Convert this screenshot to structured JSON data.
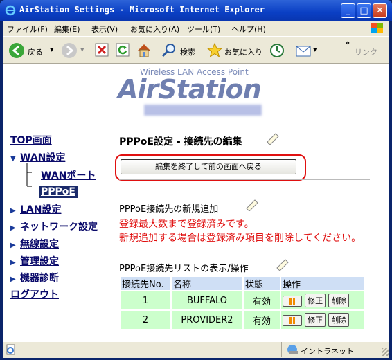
{
  "window": {
    "title": "AirStation Settings - Microsoft Internet Explorer"
  },
  "menu": [
    "ファイル(F)",
    "編集(E)",
    "表示(V)",
    "お気に入り(A)",
    "ツール(T)",
    "ヘルプ(H)"
  ],
  "toolbar": {
    "back": "戻る",
    "search": "検索",
    "favorites": "お気に入り",
    "links": "リンク",
    "chevron": "»"
  },
  "header": {
    "subtitle": "Wireless LAN Access Point",
    "logo": "AirStation"
  },
  "nav": {
    "top": "TOP画面",
    "wan": "WAN設定",
    "wan_port": "WANポート",
    "pppoe": "PPPoE",
    "lan": "LAN設定",
    "network": "ネットワーク設定",
    "wireless": "無線設定",
    "admin": "管理設定",
    "diag": "機器診断",
    "logout": "ログアウト"
  },
  "main": {
    "title": "PPPoE設定 - 接続先の編集",
    "back_button": "編集を終了して前の画面へ戻る",
    "new_section": "PPPoE接続先の新規追加",
    "warning_line1": "登録最大数まで登録済みです。",
    "warning_line2": "新規追加する場合は登録済み項目を削除してください。",
    "list_section": "PPPoE接続先リストの表示/操作",
    "table": {
      "headers": [
        "接続先No.",
        "名称",
        "状態",
        "操作"
      ],
      "rows": [
        {
          "no": "1",
          "name": "BUFFALO",
          "status": "有効"
        },
        {
          "no": "2",
          "name": "PROVIDER2",
          "status": "有効"
        }
      ],
      "edit_label": "修正",
      "delete_label": "削除"
    }
  },
  "status": {
    "zone": "イントラネット"
  }
}
